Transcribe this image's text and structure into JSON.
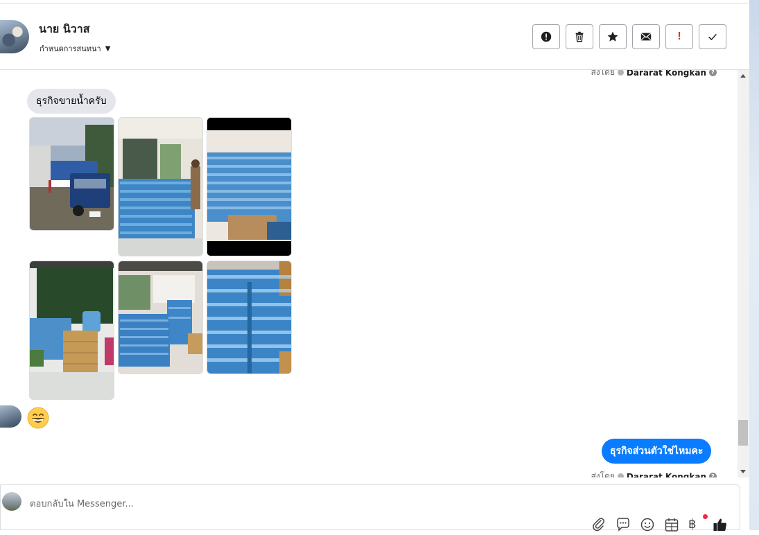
{
  "header": {
    "contact_name": "นาย นิวาส",
    "assign_label": "กำหนดการสนทนา",
    "actions": [
      {
        "name": "mark-spam-button",
        "icon": "alert-circle-icon"
      },
      {
        "name": "delete-button",
        "icon": "trash-icon"
      },
      {
        "name": "star-button",
        "icon": "star-icon"
      },
      {
        "name": "mark-unread-button",
        "icon": "envelope-icon"
      },
      {
        "name": "follow-up-button",
        "icon": "exclamation-icon"
      },
      {
        "name": "mark-done-button",
        "icon": "check-icon"
      }
    ]
  },
  "thread": {
    "sent_by_prefix": "ส่งโดย",
    "sent_by_top": "Dararat Kongkan",
    "incoming_text": "ธุรกิจขายน้ำครับ",
    "emoji": "grinning-face",
    "outgoing_text": "ธุรกิจส่วนตัวใช่ไหมคะ",
    "sent_by_bottom": "Dararat Kongkan",
    "photos": [
      {
        "name": "photo-pickup-truck",
        "subject": "pickup truck loaded with water"
      },
      {
        "name": "photo-water-stack-porch",
        "subject": "stacked water bottle packs on porch"
      },
      {
        "name": "photo-water-stack-room",
        "subject": "water packs stacked in a room"
      },
      {
        "name": "photo-water-shop-boxes",
        "subject": "water bottles and boxes in shop"
      },
      {
        "name": "photo-water-stack-garage",
        "subject": "water packs in garage"
      },
      {
        "name": "photo-water-stack-closeup",
        "subject": "close-up of stacked water packs"
      }
    ]
  },
  "composer": {
    "placeholder": "ตอบกลับใน Messenger...",
    "tools": [
      "paperclip-icon",
      "saved-replies-icon",
      "emoji-icon",
      "calendar-icon",
      "baht-payment-icon",
      "like-icon"
    ]
  },
  "colors": {
    "accent": "#0a7cff",
    "incoming_bubble": "#e4e6eb",
    "follow_up_red": "#e0321f",
    "notification_dot": "#f02849"
  }
}
